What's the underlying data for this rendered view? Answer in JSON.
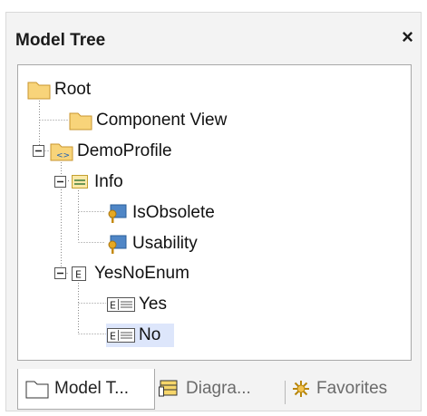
{
  "panel": {
    "title": "Model Tree",
    "close_glyph": "×"
  },
  "tree": {
    "root": "Root",
    "component_view": "Component View",
    "demo_profile": "DemoProfile",
    "info": "Info",
    "is_obsolete": "IsObsolete",
    "usability": "Usability",
    "yes_no_enum": "YesNoEnum",
    "yes": "Yes",
    "no": "No",
    "selected_item": "No",
    "icons": {
      "root": "folder-icon",
      "component_view": "folder-icon",
      "demo_profile": "profile-package-icon",
      "info": "stereotype-icon",
      "is_obsolete": "property-key-icon",
      "usability": "property-key-icon",
      "yes_no_enum": "enumeration-icon",
      "yes": "enumeration-literal-icon",
      "no": "enumeration-literal-icon"
    }
  },
  "tabs": [
    {
      "label": "Model T...",
      "icon": "folder-icon",
      "active": true
    },
    {
      "label": "Diagra...",
      "icon": "diagram-icon",
      "active": false
    },
    {
      "label": "Favorites",
      "icon": "favorites-icon",
      "active": false
    }
  ],
  "colors": {
    "folder": "#f5c55b",
    "selection": "#dde6fb",
    "key_icon": "#c48a12",
    "prop_icon": "#4f86c6"
  }
}
